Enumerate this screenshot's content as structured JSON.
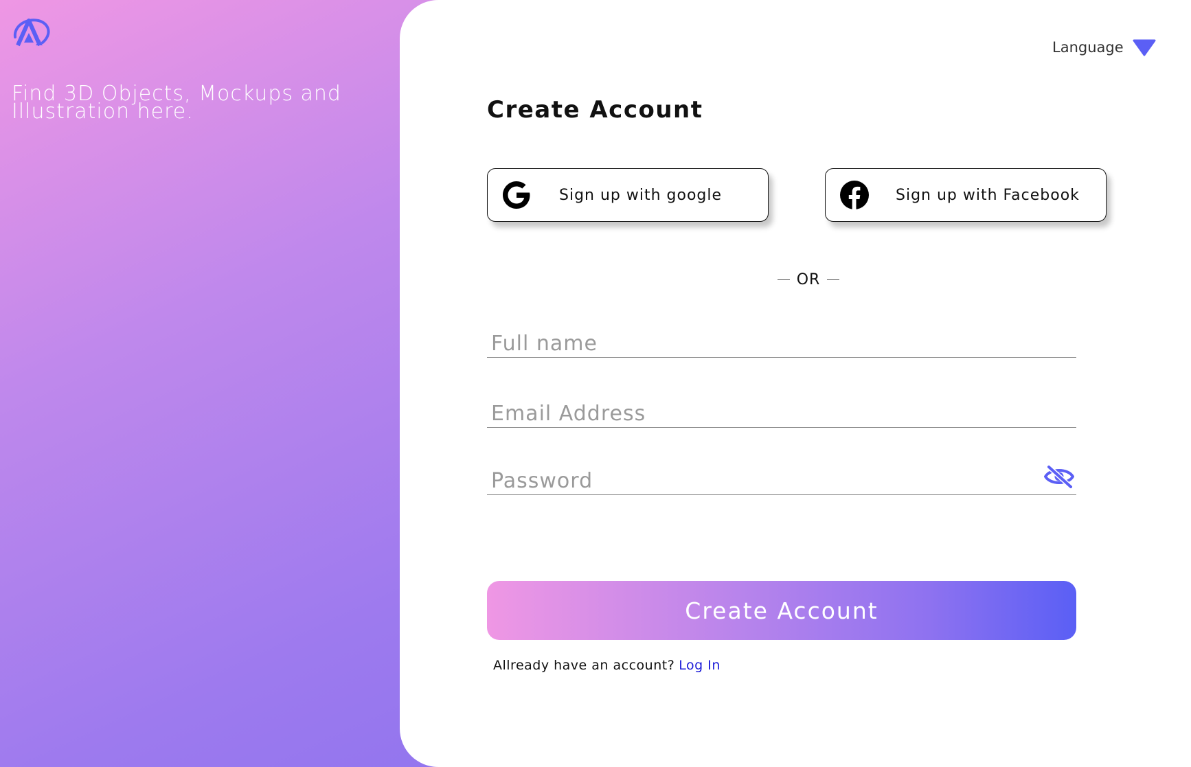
{
  "brand": {
    "tagline": "Find 3D Objects, Mockups and Illustration here.",
    "logo_icon": "brand-logo-icon",
    "accent_color": "#5b5ff5"
  },
  "header": {
    "language_label": "Language",
    "language_icon": "caret-down-icon"
  },
  "form": {
    "title": "Create Account",
    "social": {
      "google_label": "Sign up with google",
      "google_icon": "google-icon",
      "facebook_label": "Sign up with Facebook",
      "facebook_icon": "facebook-icon"
    },
    "divider_text": "OR",
    "fields": {
      "full_name": {
        "placeholder": "Full name",
        "value": ""
      },
      "email": {
        "placeholder": "Email Address",
        "value": ""
      },
      "password": {
        "placeholder": "Password",
        "value": "",
        "toggle_icon": "eye-slash-icon"
      }
    },
    "submit_label": "Create Account",
    "login_prompt": "Allready have an account?",
    "login_link": "Log In"
  },
  "colors": {
    "gradient_start": "#ef97e4",
    "gradient_end": "#5a5ff5",
    "link": "#1a1ad8"
  }
}
